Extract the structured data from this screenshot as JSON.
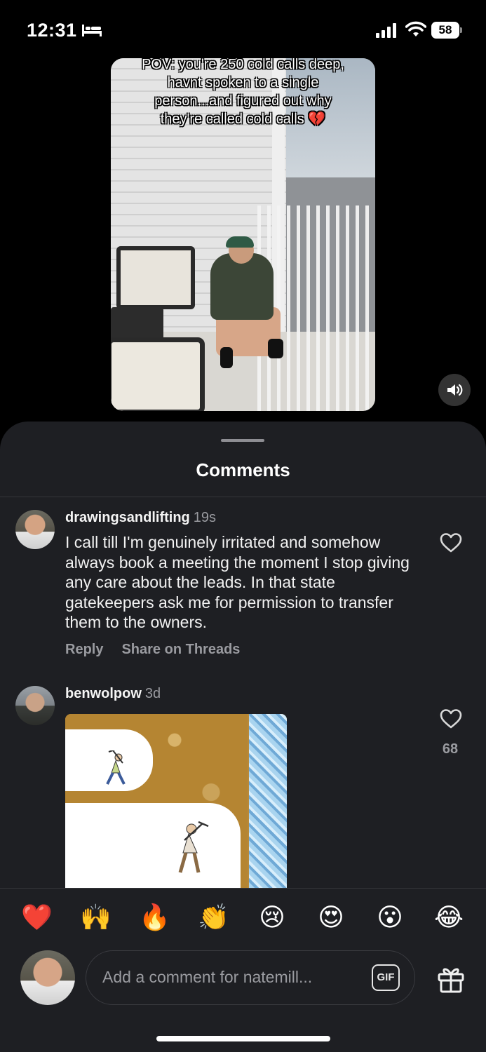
{
  "status_bar": {
    "time": "12:31",
    "battery": "58",
    "icons": [
      "bed-icon",
      "signal-icon",
      "wifi-icon",
      "battery-icon"
    ]
  },
  "video": {
    "caption": "POV: you're 250 cold calls deep, havnt spoken to a single person...and figured out why they're called cold calls 💔",
    "sound_icon": "speaker-icon"
  },
  "sheet": {
    "title": "Comments"
  },
  "comments": [
    {
      "username": "drawingsandlifting",
      "time": "19s",
      "text": "I call till I'm genuinely irritated and somehow always book a meeting the moment I stop giving any care about the leads. In that state gatekeepers ask me for permission to transfer them to the owners.",
      "actions": [
        "Reply",
        "Share on Threads"
      ]
    },
    {
      "username": "benwolpow",
      "time": "3d",
      "likes": "68",
      "media": "image"
    }
  ],
  "reactions": [
    "❤️",
    "🙌",
    "🔥",
    "👏",
    "😢",
    "😍",
    "😮",
    "😂"
  ],
  "composer": {
    "placeholder": "Add a comment for natemill...",
    "gif_label": "GIF"
  },
  "colors": {
    "sheet_bg": "#1e1f23",
    "muted_text": "#9a9ba0"
  }
}
